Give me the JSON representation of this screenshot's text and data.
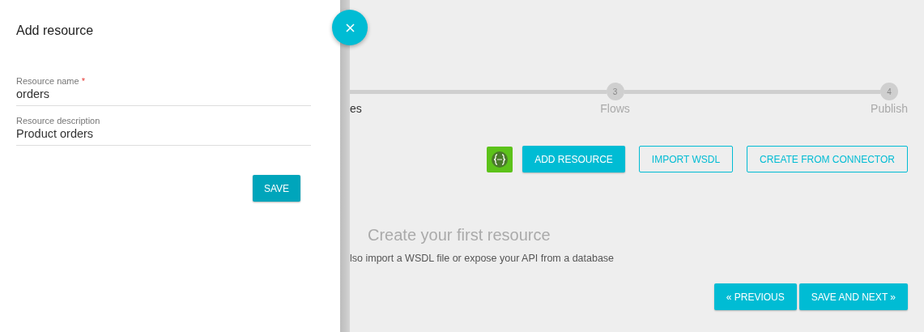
{
  "drawer": {
    "title": "Add resource",
    "fields": [
      {
        "label": "Resource name",
        "required_mark": "*",
        "value": "orders"
      },
      {
        "label": "Resource description",
        "value": "Product orders"
      }
    ],
    "save_button": "SAVE"
  },
  "stepper": {
    "steps": [
      {
        "label": "es",
        "selected": true
      },
      {
        "number": "3",
        "label": "Flows",
        "selected": false
      },
      {
        "number": "4",
        "label": "Publish",
        "selected": false
      }
    ]
  },
  "actions": [
    "ADD RESOURCE",
    "IMPORT WSDL",
    "CREATE FROM CONNECTOR"
  ],
  "empty_state": {
    "title": "Create your first resource",
    "text": "lso import a WSDL file or expose your API from a database"
  },
  "nav_buttons": [
    "« PREVIOUS",
    "SAVE AND NEXT »"
  ]
}
